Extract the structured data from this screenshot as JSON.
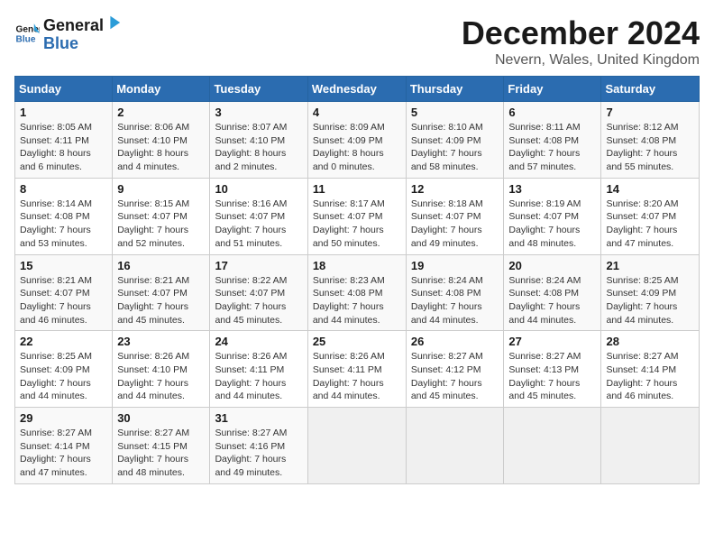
{
  "header": {
    "logo_line1": "General",
    "logo_line2": "Blue",
    "month": "December 2024",
    "location": "Nevern, Wales, United Kingdom"
  },
  "weekdays": [
    "Sunday",
    "Monday",
    "Tuesday",
    "Wednesday",
    "Thursday",
    "Friday",
    "Saturday"
  ],
  "weeks": [
    [
      {
        "day": "1",
        "sunrise": "Sunrise: 8:05 AM",
        "sunset": "Sunset: 4:11 PM",
        "daylight": "Daylight: 8 hours and 6 minutes."
      },
      {
        "day": "2",
        "sunrise": "Sunrise: 8:06 AM",
        "sunset": "Sunset: 4:10 PM",
        "daylight": "Daylight: 8 hours and 4 minutes."
      },
      {
        "day": "3",
        "sunrise": "Sunrise: 8:07 AM",
        "sunset": "Sunset: 4:10 PM",
        "daylight": "Daylight: 8 hours and 2 minutes."
      },
      {
        "day": "4",
        "sunrise": "Sunrise: 8:09 AM",
        "sunset": "Sunset: 4:09 PM",
        "daylight": "Daylight: 8 hours and 0 minutes."
      },
      {
        "day": "5",
        "sunrise": "Sunrise: 8:10 AM",
        "sunset": "Sunset: 4:09 PM",
        "daylight": "Daylight: 7 hours and 58 minutes."
      },
      {
        "day": "6",
        "sunrise": "Sunrise: 8:11 AM",
        "sunset": "Sunset: 4:08 PM",
        "daylight": "Daylight: 7 hours and 57 minutes."
      },
      {
        "day": "7",
        "sunrise": "Sunrise: 8:12 AM",
        "sunset": "Sunset: 4:08 PM",
        "daylight": "Daylight: 7 hours and 55 minutes."
      }
    ],
    [
      {
        "day": "8",
        "sunrise": "Sunrise: 8:14 AM",
        "sunset": "Sunset: 4:08 PM",
        "daylight": "Daylight: 7 hours and 53 minutes."
      },
      {
        "day": "9",
        "sunrise": "Sunrise: 8:15 AM",
        "sunset": "Sunset: 4:07 PM",
        "daylight": "Daylight: 7 hours and 52 minutes."
      },
      {
        "day": "10",
        "sunrise": "Sunrise: 8:16 AM",
        "sunset": "Sunset: 4:07 PM",
        "daylight": "Daylight: 7 hours and 51 minutes."
      },
      {
        "day": "11",
        "sunrise": "Sunrise: 8:17 AM",
        "sunset": "Sunset: 4:07 PM",
        "daylight": "Daylight: 7 hours and 50 minutes."
      },
      {
        "day": "12",
        "sunrise": "Sunrise: 8:18 AM",
        "sunset": "Sunset: 4:07 PM",
        "daylight": "Daylight: 7 hours and 49 minutes."
      },
      {
        "day": "13",
        "sunrise": "Sunrise: 8:19 AM",
        "sunset": "Sunset: 4:07 PM",
        "daylight": "Daylight: 7 hours and 48 minutes."
      },
      {
        "day": "14",
        "sunrise": "Sunrise: 8:20 AM",
        "sunset": "Sunset: 4:07 PM",
        "daylight": "Daylight: 7 hours and 47 minutes."
      }
    ],
    [
      {
        "day": "15",
        "sunrise": "Sunrise: 8:21 AM",
        "sunset": "Sunset: 4:07 PM",
        "daylight": "Daylight: 7 hours and 46 minutes."
      },
      {
        "day": "16",
        "sunrise": "Sunrise: 8:21 AM",
        "sunset": "Sunset: 4:07 PM",
        "daylight": "Daylight: 7 hours and 45 minutes."
      },
      {
        "day": "17",
        "sunrise": "Sunrise: 8:22 AM",
        "sunset": "Sunset: 4:07 PM",
        "daylight": "Daylight: 7 hours and 45 minutes."
      },
      {
        "day": "18",
        "sunrise": "Sunrise: 8:23 AM",
        "sunset": "Sunset: 4:08 PM",
        "daylight": "Daylight: 7 hours and 44 minutes."
      },
      {
        "day": "19",
        "sunrise": "Sunrise: 8:24 AM",
        "sunset": "Sunset: 4:08 PM",
        "daylight": "Daylight: 7 hours and 44 minutes."
      },
      {
        "day": "20",
        "sunrise": "Sunrise: 8:24 AM",
        "sunset": "Sunset: 4:08 PM",
        "daylight": "Daylight: 7 hours and 44 minutes."
      },
      {
        "day": "21",
        "sunrise": "Sunrise: 8:25 AM",
        "sunset": "Sunset: 4:09 PM",
        "daylight": "Daylight: 7 hours and 44 minutes."
      }
    ],
    [
      {
        "day": "22",
        "sunrise": "Sunrise: 8:25 AM",
        "sunset": "Sunset: 4:09 PM",
        "daylight": "Daylight: 7 hours and 44 minutes."
      },
      {
        "day": "23",
        "sunrise": "Sunrise: 8:26 AM",
        "sunset": "Sunset: 4:10 PM",
        "daylight": "Daylight: 7 hours and 44 minutes."
      },
      {
        "day": "24",
        "sunrise": "Sunrise: 8:26 AM",
        "sunset": "Sunset: 4:11 PM",
        "daylight": "Daylight: 7 hours and 44 minutes."
      },
      {
        "day": "25",
        "sunrise": "Sunrise: 8:26 AM",
        "sunset": "Sunset: 4:11 PM",
        "daylight": "Daylight: 7 hours and 44 minutes."
      },
      {
        "day": "26",
        "sunrise": "Sunrise: 8:27 AM",
        "sunset": "Sunset: 4:12 PM",
        "daylight": "Daylight: 7 hours and 45 minutes."
      },
      {
        "day": "27",
        "sunrise": "Sunrise: 8:27 AM",
        "sunset": "Sunset: 4:13 PM",
        "daylight": "Daylight: 7 hours and 45 minutes."
      },
      {
        "day": "28",
        "sunrise": "Sunrise: 8:27 AM",
        "sunset": "Sunset: 4:14 PM",
        "daylight": "Daylight: 7 hours and 46 minutes."
      }
    ],
    [
      {
        "day": "29",
        "sunrise": "Sunrise: 8:27 AM",
        "sunset": "Sunset: 4:14 PM",
        "daylight": "Daylight: 7 hours and 47 minutes."
      },
      {
        "day": "30",
        "sunrise": "Sunrise: 8:27 AM",
        "sunset": "Sunset: 4:15 PM",
        "daylight": "Daylight: 7 hours and 48 minutes."
      },
      {
        "day": "31",
        "sunrise": "Sunrise: 8:27 AM",
        "sunset": "Sunset: 4:16 PM",
        "daylight": "Daylight: 7 hours and 49 minutes."
      },
      null,
      null,
      null,
      null
    ]
  ]
}
